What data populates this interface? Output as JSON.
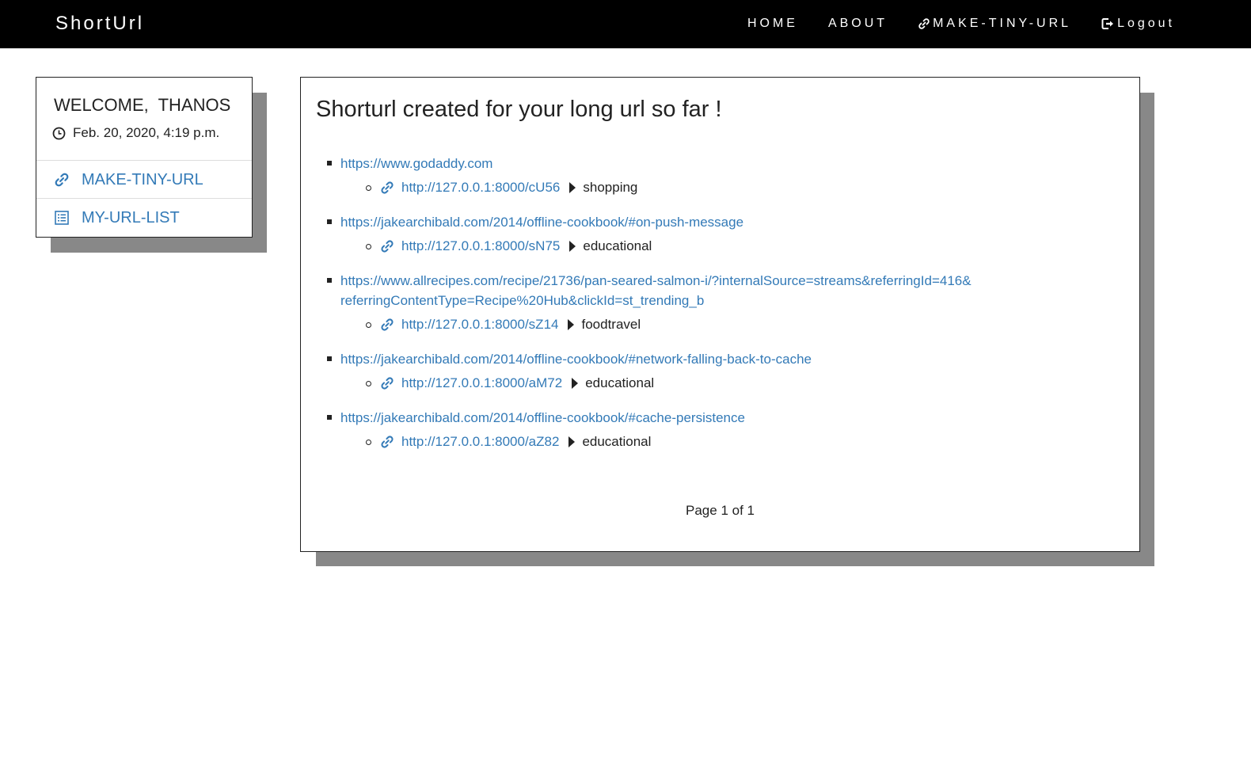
{
  "navbar": {
    "brand": "ShortUrl",
    "links": [
      {
        "label": "HOME"
      },
      {
        "label": "ABOUT"
      },
      {
        "label": "MAKE-TINY-URL",
        "icon": "link-icon"
      },
      {
        "label": "Logout",
        "icon": "logout-icon"
      }
    ]
  },
  "sidebar": {
    "welcome": "WELCOME,  THANOS",
    "datetime": "Feb. 20, 2020, 4:19 p.m.",
    "items": [
      {
        "label": "MAKE-TINY-URL",
        "icon": "link-icon"
      },
      {
        "label": "MY-URL-LIST",
        "icon": "list-icon"
      }
    ]
  },
  "main": {
    "title": "Shorturl created for your long url so far !",
    "urls": [
      {
        "long": "https://www.godaddy.com",
        "short": "http://127.0.0.1:8000/cU56",
        "tag": "shopping"
      },
      {
        "long": "https://jakearchibald.com/2014/offline-cookbook/#on-push-message",
        "short": "http://127.0.0.1:8000/sN75",
        "tag": "educational"
      },
      {
        "long": "https://www.allrecipes.com/recipe/21736/pan-seared-salmon-i/?internalSource=streams&referringId=416&referringContentType=Recipe%20Hub&clickId=st_trending_b",
        "short": "http://127.0.0.1:8000/sZ14",
        "tag": "foodtravel"
      },
      {
        "long": "https://jakearchibald.com/2014/offline-cookbook/#network-falling-back-to-cache",
        "short": "http://127.0.0.1:8000/aM72",
        "tag": "educational"
      },
      {
        "long": "https://jakearchibald.com/2014/offline-cookbook/#cache-persistence",
        "short": "http://127.0.0.1:8000/aZ82",
        "tag": "educational"
      }
    ],
    "pager": "Page 1 of 1"
  },
  "colors": {
    "link": "#337ab7",
    "navbar_bg": "#000000",
    "shadow": "#888888"
  }
}
